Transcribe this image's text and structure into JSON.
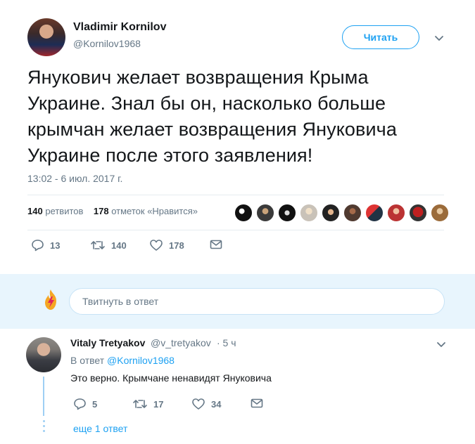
{
  "tweet": {
    "author_name": "Vladimir Kornilov",
    "author_handle": "@Kornilov1968",
    "follow_label": "Читать",
    "text": "Янукович желает возвращения Крыма Украине. Знал бы он, насколько больше крымчан желает возвращения Януковича Украине после этого заявления!",
    "timestamp": "13:02 - 6 июл. 2017 г.",
    "retweets_count": "140",
    "retweets_label": "ретвитов",
    "likes_count": "178",
    "likes_label": "отметок «Нравится»",
    "actions": {
      "reply_count": "13",
      "retweet_count": "140",
      "like_count": "178"
    }
  },
  "reply_box": {
    "placeholder": "Твитнуть в ответ"
  },
  "reply": {
    "author_name": "Vitaly Tretyakov",
    "author_handle": "@v_tretyakov",
    "time": "· 5 ч",
    "in_reply_prefix": "В ответ",
    "in_reply_handle": "@Kornilov1968",
    "text": "Это верно. Крымчане ненавидят Януковича",
    "actions": {
      "reply_count": "5",
      "retweet_count": "17",
      "like_count": "34"
    },
    "more_replies": "еще 1 ответ"
  },
  "colors": {
    "accent": "#1da1f2",
    "muted": "#657786",
    "reply_bar_bg": "#e8f5fd"
  },
  "icons": [
    "chevron-down-icon",
    "reply-icon",
    "retweet-icon",
    "like-icon",
    "dm-icon",
    "compose-flame-icon"
  ]
}
